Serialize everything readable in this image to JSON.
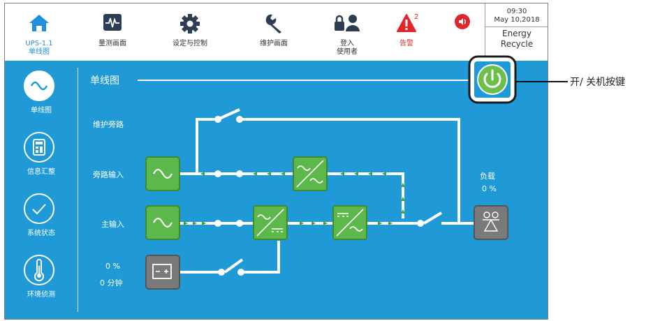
{
  "toolbar": {
    "home": {
      "label_line1": "UPS-1.1",
      "label_line2": "单线图"
    },
    "measure": {
      "label": "量测画面"
    },
    "settings": {
      "label": "设定与控制"
    },
    "maintenance": {
      "label": "维护画面"
    },
    "login": {
      "label_line1": "登入",
      "label_line2": "使用者"
    },
    "alarm": {
      "label": "告警",
      "count": "2"
    },
    "time": "09:30",
    "date": "May 10,2018",
    "mode_line1": "Energy",
    "mode_line2": "Recycle"
  },
  "sidebar": {
    "items": [
      {
        "label": "单线图"
      },
      {
        "label": "信息汇整"
      },
      {
        "label": "系统状态"
      },
      {
        "label": "环境侦测"
      }
    ]
  },
  "diagram": {
    "title": "单线图",
    "maintenance_bypass": "维护旁路",
    "bypass_input": "旁路输入",
    "main_input": "主输入",
    "battery_percent": "0 %",
    "battery_time": "0 分钟",
    "load_label": "负载",
    "load_percent": "0 %"
  },
  "callout": {
    "label": "开/ 关机按键"
  },
  "colors": {
    "accent_blue": "#1f9ad6",
    "module_green": "#5cb84a",
    "alarm_red": "#e0262a",
    "power_green": "#6cc04a"
  }
}
